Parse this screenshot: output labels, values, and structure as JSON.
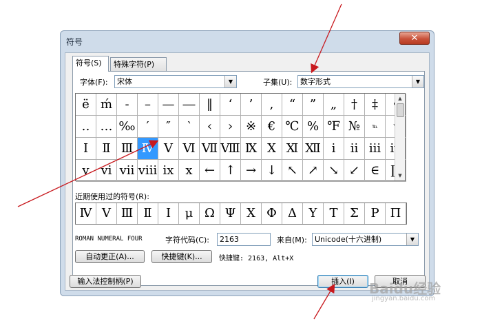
{
  "dialog": {
    "title": "符号",
    "close": "✕",
    "tabs": [
      {
        "label": "符号(S)"
      },
      {
        "label": "特殊字符(P)"
      }
    ],
    "font_label": "字体(F):",
    "font_value": "宋体",
    "subset_label": "子集(U):",
    "subset_value": "数字形式",
    "grid": [
      [
        "ë",
        "ḿ",
        "-",
        "–",
        "—",
        "―",
        "‖",
        "‘",
        "’",
        ",",
        "“",
        "”",
        "„",
        "†",
        "‡",
        "•"
      ],
      [
        "‥",
        "…",
        "‰",
        "′",
        "″",
        "‵",
        "‹",
        "›",
        "※",
        "€",
        "℃",
        "%",
        "℉",
        "№",
        "℡",
        "™"
      ],
      [
        "Ⅰ",
        "Ⅱ",
        "Ⅲ",
        "Ⅳ",
        "Ⅴ",
        "Ⅵ",
        "Ⅶ",
        "Ⅷ",
        "Ⅸ",
        "Ⅹ",
        "Ⅺ",
        "Ⅻ",
        "ⅰ",
        "ⅱ",
        "ⅲ",
        "ⅳ"
      ],
      [
        "ⅴ",
        "ⅵ",
        "ⅶ",
        "ⅷ",
        "ⅸ",
        "ⅹ",
        "←",
        "↑",
        "→",
        "↓",
        "↖",
        "↗",
        "↘",
        "↙",
        "∈",
        "∏"
      ]
    ],
    "recent_label": "近期使用过的符号(R):",
    "recent": [
      "Ⅳ",
      "Ⅴ",
      "Ⅲ",
      "Ⅱ",
      "Ⅰ",
      "μ",
      "Ω",
      "Ψ",
      "Χ",
      "Φ",
      "Δ",
      "Υ",
      "Τ",
      "Σ",
      "Ρ",
      "Π"
    ],
    "char_name": "ROMAN NUMERAL FOUR",
    "char_code_label": "字符代码(C):",
    "char_code_value": "2163",
    "from_label": "来自(M):",
    "from_value": "Unicode(十六进制)",
    "autocorrect_btn": "自动更正(A)...",
    "shortcut_btn": "快捷键(K)...",
    "shortcut_text": "快捷键: 2163, Alt+X",
    "ime_btn": "输入法控制柄(P)",
    "insert_btn": "插入(I)",
    "cancel_btn": "取消"
  },
  "watermark": {
    "logo": "Baidu经验",
    "sub": "jingyan.baidu.com"
  },
  "colors": {
    "selection": "#3399ff",
    "annotation_arrow": "#c8191e"
  }
}
